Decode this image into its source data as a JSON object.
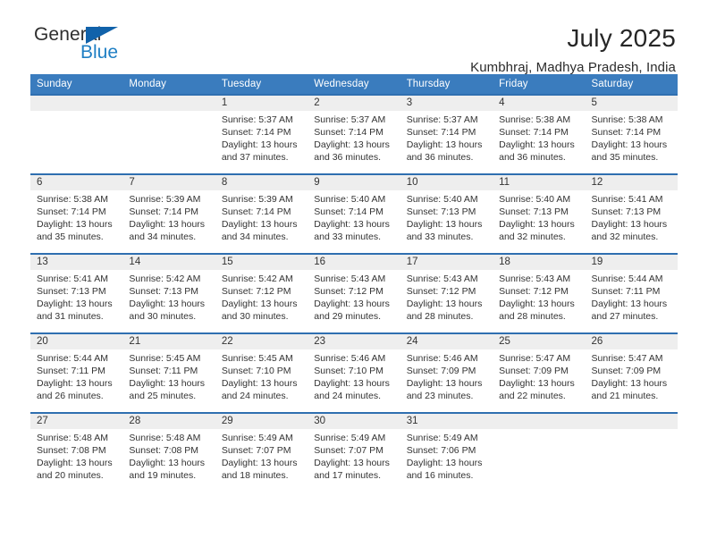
{
  "brand": {
    "name_part1": "General",
    "name_part2": "Blue",
    "triangle_color": "#1162aa",
    "blue_color": "#1f7fc4"
  },
  "header": {
    "month_title": "July 2025",
    "location": "Kumbhraj, Madhya Pradesh, India"
  },
  "theme": {
    "header_bg": "#3a7cbe",
    "row_border": "#2f6fb0",
    "daynum_bg": "#eeeeee"
  },
  "weekday_headers": [
    "Sunday",
    "Monday",
    "Tuesday",
    "Wednesday",
    "Thursday",
    "Friday",
    "Saturday"
  ],
  "weeks": [
    [
      {
        "day": "",
        "sunrise": "",
        "sunset": "",
        "daylight_line1": "",
        "daylight_line2": ""
      },
      {
        "day": "",
        "sunrise": "",
        "sunset": "",
        "daylight_line1": "",
        "daylight_line2": ""
      },
      {
        "day": "1",
        "sunrise": "Sunrise: 5:37 AM",
        "sunset": "Sunset: 7:14 PM",
        "daylight_line1": "Daylight: 13 hours",
        "daylight_line2": "and 37 minutes."
      },
      {
        "day": "2",
        "sunrise": "Sunrise: 5:37 AM",
        "sunset": "Sunset: 7:14 PM",
        "daylight_line1": "Daylight: 13 hours",
        "daylight_line2": "and 36 minutes."
      },
      {
        "day": "3",
        "sunrise": "Sunrise: 5:37 AM",
        "sunset": "Sunset: 7:14 PM",
        "daylight_line1": "Daylight: 13 hours",
        "daylight_line2": "and 36 minutes."
      },
      {
        "day": "4",
        "sunrise": "Sunrise: 5:38 AM",
        "sunset": "Sunset: 7:14 PM",
        "daylight_line1": "Daylight: 13 hours",
        "daylight_line2": "and 36 minutes."
      },
      {
        "day": "5",
        "sunrise": "Sunrise: 5:38 AM",
        "sunset": "Sunset: 7:14 PM",
        "daylight_line1": "Daylight: 13 hours",
        "daylight_line2": "and 35 minutes."
      }
    ],
    [
      {
        "day": "6",
        "sunrise": "Sunrise: 5:38 AM",
        "sunset": "Sunset: 7:14 PM",
        "daylight_line1": "Daylight: 13 hours",
        "daylight_line2": "and 35 minutes."
      },
      {
        "day": "7",
        "sunrise": "Sunrise: 5:39 AM",
        "sunset": "Sunset: 7:14 PM",
        "daylight_line1": "Daylight: 13 hours",
        "daylight_line2": "and 34 minutes."
      },
      {
        "day": "8",
        "sunrise": "Sunrise: 5:39 AM",
        "sunset": "Sunset: 7:14 PM",
        "daylight_line1": "Daylight: 13 hours",
        "daylight_line2": "and 34 minutes."
      },
      {
        "day": "9",
        "sunrise": "Sunrise: 5:40 AM",
        "sunset": "Sunset: 7:14 PM",
        "daylight_line1": "Daylight: 13 hours",
        "daylight_line2": "and 33 minutes."
      },
      {
        "day": "10",
        "sunrise": "Sunrise: 5:40 AM",
        "sunset": "Sunset: 7:13 PM",
        "daylight_line1": "Daylight: 13 hours",
        "daylight_line2": "and 33 minutes."
      },
      {
        "day": "11",
        "sunrise": "Sunrise: 5:40 AM",
        "sunset": "Sunset: 7:13 PM",
        "daylight_line1": "Daylight: 13 hours",
        "daylight_line2": "and 32 minutes."
      },
      {
        "day": "12",
        "sunrise": "Sunrise: 5:41 AM",
        "sunset": "Sunset: 7:13 PM",
        "daylight_line1": "Daylight: 13 hours",
        "daylight_line2": "and 32 minutes."
      }
    ],
    [
      {
        "day": "13",
        "sunrise": "Sunrise: 5:41 AM",
        "sunset": "Sunset: 7:13 PM",
        "daylight_line1": "Daylight: 13 hours",
        "daylight_line2": "and 31 minutes."
      },
      {
        "day": "14",
        "sunrise": "Sunrise: 5:42 AM",
        "sunset": "Sunset: 7:13 PM",
        "daylight_line1": "Daylight: 13 hours",
        "daylight_line2": "and 30 minutes."
      },
      {
        "day": "15",
        "sunrise": "Sunrise: 5:42 AM",
        "sunset": "Sunset: 7:12 PM",
        "daylight_line1": "Daylight: 13 hours",
        "daylight_line2": "and 30 minutes."
      },
      {
        "day": "16",
        "sunrise": "Sunrise: 5:43 AM",
        "sunset": "Sunset: 7:12 PM",
        "daylight_line1": "Daylight: 13 hours",
        "daylight_line2": "and 29 minutes."
      },
      {
        "day": "17",
        "sunrise": "Sunrise: 5:43 AM",
        "sunset": "Sunset: 7:12 PM",
        "daylight_line1": "Daylight: 13 hours",
        "daylight_line2": "and 28 minutes."
      },
      {
        "day": "18",
        "sunrise": "Sunrise: 5:43 AM",
        "sunset": "Sunset: 7:12 PM",
        "daylight_line1": "Daylight: 13 hours",
        "daylight_line2": "and 28 minutes."
      },
      {
        "day": "19",
        "sunrise": "Sunrise: 5:44 AM",
        "sunset": "Sunset: 7:11 PM",
        "daylight_line1": "Daylight: 13 hours",
        "daylight_line2": "and 27 minutes."
      }
    ],
    [
      {
        "day": "20",
        "sunrise": "Sunrise: 5:44 AM",
        "sunset": "Sunset: 7:11 PM",
        "daylight_line1": "Daylight: 13 hours",
        "daylight_line2": "and 26 minutes."
      },
      {
        "day": "21",
        "sunrise": "Sunrise: 5:45 AM",
        "sunset": "Sunset: 7:11 PM",
        "daylight_line1": "Daylight: 13 hours",
        "daylight_line2": "and 25 minutes."
      },
      {
        "day": "22",
        "sunrise": "Sunrise: 5:45 AM",
        "sunset": "Sunset: 7:10 PM",
        "daylight_line1": "Daylight: 13 hours",
        "daylight_line2": "and 24 minutes."
      },
      {
        "day": "23",
        "sunrise": "Sunrise: 5:46 AM",
        "sunset": "Sunset: 7:10 PM",
        "daylight_line1": "Daylight: 13 hours",
        "daylight_line2": "and 24 minutes."
      },
      {
        "day": "24",
        "sunrise": "Sunrise: 5:46 AM",
        "sunset": "Sunset: 7:09 PM",
        "daylight_line1": "Daylight: 13 hours",
        "daylight_line2": "and 23 minutes."
      },
      {
        "day": "25",
        "sunrise": "Sunrise: 5:47 AM",
        "sunset": "Sunset: 7:09 PM",
        "daylight_line1": "Daylight: 13 hours",
        "daylight_line2": "and 22 minutes."
      },
      {
        "day": "26",
        "sunrise": "Sunrise: 5:47 AM",
        "sunset": "Sunset: 7:09 PM",
        "daylight_line1": "Daylight: 13 hours",
        "daylight_line2": "and 21 minutes."
      }
    ],
    [
      {
        "day": "27",
        "sunrise": "Sunrise: 5:48 AM",
        "sunset": "Sunset: 7:08 PM",
        "daylight_line1": "Daylight: 13 hours",
        "daylight_line2": "and 20 minutes."
      },
      {
        "day": "28",
        "sunrise": "Sunrise: 5:48 AM",
        "sunset": "Sunset: 7:08 PM",
        "daylight_line1": "Daylight: 13 hours",
        "daylight_line2": "and 19 minutes."
      },
      {
        "day": "29",
        "sunrise": "Sunrise: 5:49 AM",
        "sunset": "Sunset: 7:07 PM",
        "daylight_line1": "Daylight: 13 hours",
        "daylight_line2": "and 18 minutes."
      },
      {
        "day": "30",
        "sunrise": "Sunrise: 5:49 AM",
        "sunset": "Sunset: 7:07 PM",
        "daylight_line1": "Daylight: 13 hours",
        "daylight_line2": "and 17 minutes."
      },
      {
        "day": "31",
        "sunrise": "Sunrise: 5:49 AM",
        "sunset": "Sunset: 7:06 PM",
        "daylight_line1": "Daylight: 13 hours",
        "daylight_line2": "and 16 minutes."
      },
      {
        "day": "",
        "sunrise": "",
        "sunset": "",
        "daylight_line1": "",
        "daylight_line2": ""
      },
      {
        "day": "",
        "sunrise": "",
        "sunset": "",
        "daylight_line1": "",
        "daylight_line2": ""
      }
    ]
  ]
}
